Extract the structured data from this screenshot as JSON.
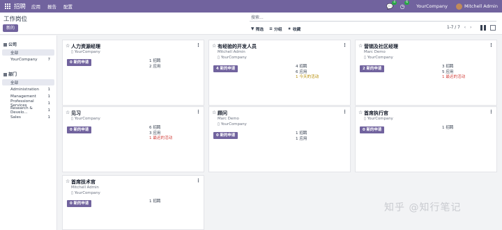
{
  "navbar": {
    "app_name": "招聘",
    "menus": [
      "应用",
      "报告",
      "配置"
    ],
    "chat_badge": "4",
    "activity_badge": "6",
    "company": "YourCompany",
    "user": "Mitchell Admin",
    "accent": "#71639e"
  },
  "control": {
    "title": "工作岗位",
    "new_button": "新的",
    "search_placeholder": "搜索...",
    "filter": "筛选",
    "group": "分组",
    "favorites": "收藏",
    "pager": "1-7 / 7"
  },
  "sidebar": {
    "company_heading": "公司",
    "company_items": [
      {
        "label": "全部",
        "count": ""
      },
      {
        "label": "YourCompany",
        "count": "7"
      }
    ],
    "department_heading": "部门",
    "department_items": [
      {
        "label": "全部",
        "count": ""
      },
      {
        "label": "Administration",
        "count": "1"
      },
      {
        "label": "Management",
        "count": "1"
      },
      {
        "label": "Professional Services",
        "count": "1"
      },
      {
        "label": "Research & Develo...",
        "count": "1"
      },
      {
        "label": "Sales",
        "count": "1"
      }
    ]
  },
  "cards": [
    {
      "title": "人力资源经理",
      "sub1": "",
      "company": "YourCompany",
      "apps_button": "0 新的申请",
      "recruit": "1 招聘",
      "apps": "2 应用",
      "activity": "",
      "activity_kind": ""
    },
    {
      "title": "有经验的开发人员",
      "sub1": "Mitchell Admin",
      "company": "YourCompany",
      "apps_button": "4 新的申请",
      "recruit": "4 招聘",
      "apps": "6 应用",
      "activity": "1 今天的活动",
      "activity_kind": "warn"
    },
    {
      "title": "营销及社区经理",
      "sub1": "Marc Demo",
      "company": "YourCompany",
      "apps_button": "2 新的申请",
      "recruit": "3 招聘",
      "apps": "5 应用",
      "activity": "1 最迟的活动",
      "activity_kind": "late"
    },
    {
      "title": "见习",
      "sub1": "",
      "company": "YourCompany",
      "apps_button": "0 新的申请",
      "recruit": "6 招聘",
      "apps": "3 应用",
      "activity": "1 最迟的活动",
      "activity_kind": "late"
    },
    {
      "title": "顾问",
      "sub1": "Marc Demo",
      "company": "YourCompany",
      "apps_button": "0 新的申请",
      "recruit": "1 招聘",
      "apps": "1 应用",
      "activity": "",
      "activity_kind": ""
    },
    {
      "title": "首席执行官",
      "sub1": "",
      "company": "YourCompany",
      "apps_button": "0 新的申请",
      "recruit": "1 招聘",
      "apps": "",
      "activity": "",
      "activity_kind": ""
    },
    {
      "title": "首席技术官",
      "sub1": "Mitchell Admin",
      "company": "YourCompany",
      "apps_button": "0 新的申请",
      "recruit": "1 招聘",
      "apps": "",
      "activity": "",
      "activity_kind": ""
    }
  ],
  "watermark": "知乎 @知行笔记"
}
